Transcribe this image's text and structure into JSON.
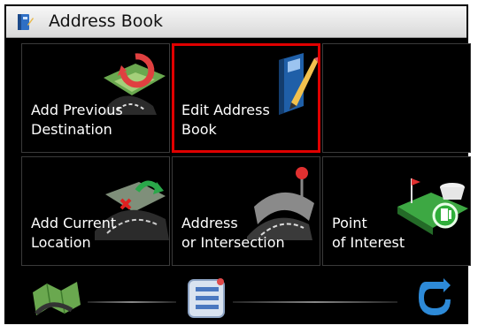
{
  "window": {
    "title": "Address Book",
    "title_icon": "address-book-icon"
  },
  "grid": {
    "row1": [
      {
        "label": "Add Previous\nDestination",
        "icon": "map-refresh-icon",
        "selected": false
      },
      {
        "label": "Edit Address\nBook",
        "icon": "address-book-pencil-icon",
        "selected": true
      },
      {
        "label": "",
        "icon": "",
        "selected": false
      }
    ],
    "row2": [
      {
        "label": "Add Current\nLocation",
        "icon": "road-add-icon",
        "selected": false
      },
      {
        "label": "Address\nor Intersection",
        "icon": "road-pin-icon",
        "selected": false
      },
      {
        "label": "Point\nof Interest",
        "icon": "poi-icon",
        "selected": false
      }
    ]
  },
  "toolbar": {
    "left_icon": "map-icon",
    "center_icon": "list-menu-icon",
    "right_icon": "back-arrow-icon"
  },
  "colors": {
    "selected_border": "#e00000",
    "background": "#000000",
    "title_bar": "#e6e6e6"
  }
}
